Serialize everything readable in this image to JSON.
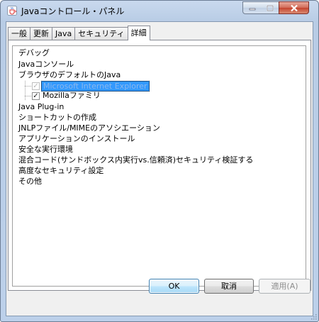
{
  "window": {
    "title": "Javaコントロール・パネル"
  },
  "tabs": [
    {
      "label": "一般"
    },
    {
      "label": "更新"
    },
    {
      "label": "Java"
    },
    {
      "label": "セキュリティ"
    },
    {
      "label": "詳細"
    }
  ],
  "tree": {
    "items": [
      {
        "label": "デバッグ"
      },
      {
        "label": "Javaコンソール"
      },
      {
        "label": "ブラウザのデフォルトのJava"
      },
      {
        "label": "Microsoft Internet Explorer",
        "checked": true,
        "disabled": true,
        "selected": true
      },
      {
        "label": "Mozillaファミリ",
        "checked": true
      },
      {
        "label": "Java Plug-in"
      },
      {
        "label": "ショートカットの作成"
      },
      {
        "label": "JNLPファイル/MIMEのアソシエーション"
      },
      {
        "label": "アプリケーションのインストール"
      },
      {
        "label": "安全な実行環境"
      },
      {
        "label": "混合コード(サンドボックス内実行vs.信頼済)セキュリティ検証する"
      },
      {
        "label": "高度なセキュリティ設定"
      },
      {
        "label": "その他"
      }
    ]
  },
  "buttons": {
    "ok": "OK",
    "cancel": "取消",
    "apply": "適用(A)"
  },
  "colors": {
    "selection": "#3399ff",
    "close_button": "#c4432e"
  }
}
